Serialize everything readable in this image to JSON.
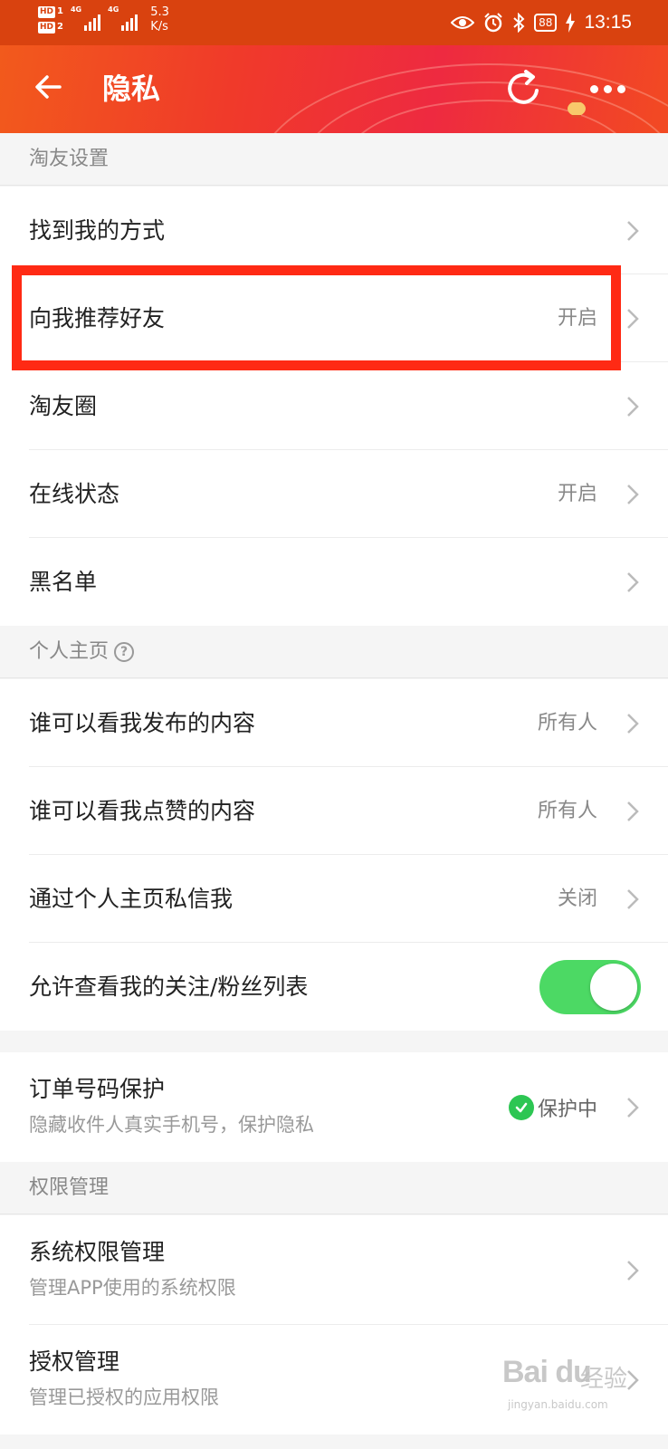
{
  "status_bar": {
    "sim1": "HD",
    "sim1_num": "1",
    "sim2": "HD",
    "sim2_num": "2",
    "network1": "4G",
    "network2": "4G",
    "speed_value": "5.3",
    "speed_unit": "K/s",
    "battery": "88",
    "time": "13:15"
  },
  "navbar": {
    "title": "隐私",
    "icons": [
      "back-arrow-icon",
      "refresh-icon",
      "lantern-icon",
      "more-icon"
    ]
  },
  "sections": {
    "taoyou": {
      "header": "淘友设置",
      "items": [
        {
          "label": "找到我的方式",
          "value": ""
        },
        {
          "label": "向我推荐好友",
          "value": "开启"
        },
        {
          "label": "淘友圈",
          "value": ""
        },
        {
          "label": "在线状态",
          "value": "开启"
        },
        {
          "label": "黑名单",
          "value": ""
        }
      ]
    },
    "profile": {
      "header": "个人主页",
      "help_icon": "?",
      "items": [
        {
          "label": "谁可以看我发布的内容",
          "value": "所有人"
        },
        {
          "label": "谁可以看我点赞的内容",
          "value": "所有人"
        },
        {
          "label": "通过个人主页私信我",
          "value": "关闭"
        },
        {
          "label": "允许查看我的关注/粉丝列表",
          "toggle": true
        }
      ]
    },
    "order": {
      "items": [
        {
          "label": "订单号码保护",
          "desc": "隐藏收件人真实手机号，保护隐私",
          "value": "保护中"
        }
      ]
    },
    "permissions": {
      "header": "权限管理",
      "items": [
        {
          "label": "系统权限管理",
          "desc": "管理APP使用的系统权限"
        },
        {
          "label": "授权管理",
          "desc": "管理已授权的应用权限"
        }
      ]
    }
  },
  "watermark": {
    "logo": "Bai du",
    "cn": "经验",
    "url": "jingyan.baidu.com"
  },
  "colors": {
    "status_bar": "#d9420f",
    "navbar": "#f03a2a",
    "highlight": "#ff2a14",
    "toggle_on": "#4cd964",
    "check": "#2dc653"
  }
}
